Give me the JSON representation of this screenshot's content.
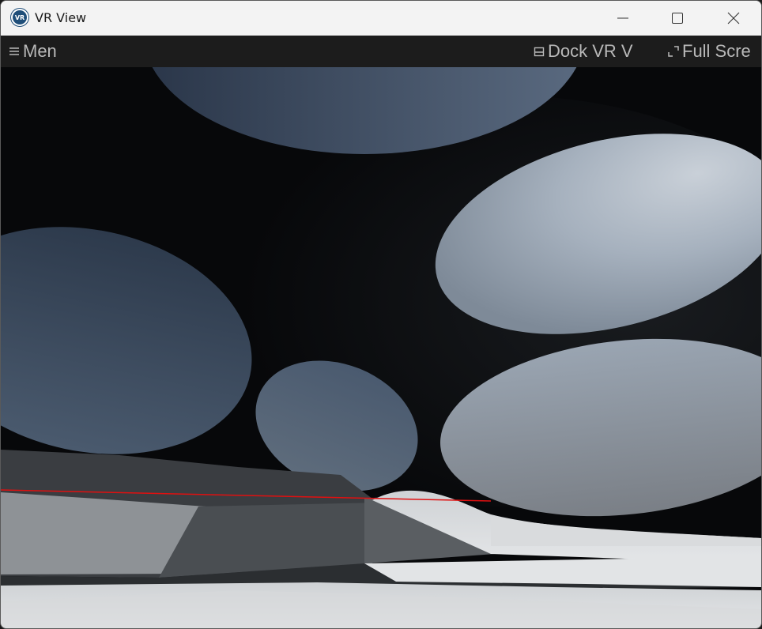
{
  "window": {
    "title": "VR View",
    "app_icon_text": "VR",
    "app_icon": "vr-app-icon",
    "controls": {
      "minimize_icon": "minimize-icon",
      "maximize_icon": "maximize-icon",
      "close_icon": "close-icon"
    }
  },
  "toolbar": {
    "menu_label": "Men",
    "menu_icon": "hamburger-icon",
    "dock_label": "Dock VR V",
    "dock_icon": "dock-icon",
    "fullscreen_label": "Full Scre",
    "fullscreen_icon": "fullscreen-icon"
  },
  "colors": {
    "toolbar_bg": "#1c1c1c",
    "toolbar_text": "#b9b9b9",
    "laser": "#e01010",
    "titlebar_bg": "#f3f3f3"
  }
}
